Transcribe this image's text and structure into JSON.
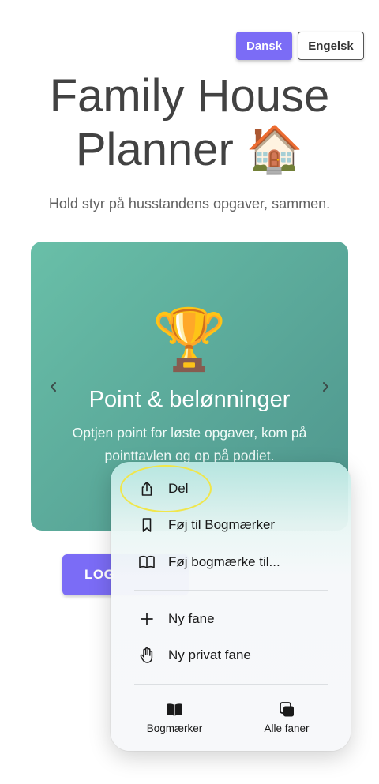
{
  "language": {
    "dansk_label": "Dansk",
    "engelsk_label": "Engelsk",
    "active": "Dansk"
  },
  "header": {
    "title_line1": "Family House",
    "title_line2": "Planner 🏠",
    "subtitle": "Hold styr på husstandens opgaver, sammen."
  },
  "carousel": {
    "emoji": "🏆",
    "heading": "Point & belønninger",
    "text": "Optjen point for løste opgaver, kom på pointtavlen og op på podiet."
  },
  "login": {
    "label": "LOG"
  },
  "context_menu": {
    "items": [
      {
        "label": "Del",
        "icon": "share-icon"
      },
      {
        "label": "Føj til Bogmærker",
        "icon": "bookmark-icon"
      },
      {
        "label": "Føj bogmærke til...",
        "icon": "book-open-icon"
      },
      {
        "label": "Ny fane",
        "icon": "plus-icon"
      },
      {
        "label": "Ny privat fane",
        "icon": "hand-icon"
      }
    ],
    "bottom_tabs": [
      {
        "label": "Bogmærker",
        "icon": "bookmarks-icon"
      },
      {
        "label": "Alle faner",
        "icon": "tabs-icon"
      }
    ]
  },
  "colors": {
    "accent": "#7b6cf6",
    "card_start": "#69bfa8",
    "card_end": "#4e958d",
    "highlight_ring": "#f0e64a"
  }
}
